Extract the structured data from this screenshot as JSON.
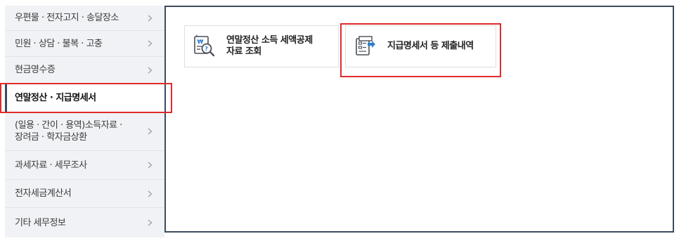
{
  "sidebar": {
    "items": [
      {
        "label": "우편물 · 전자고지 · 송달장소",
        "has_chevron": true,
        "active": false
      },
      {
        "label": "민원 · 상담 · 불복 · 고충",
        "has_chevron": true,
        "active": false
      },
      {
        "label": "현금영수증",
        "has_chevron": true,
        "active": false
      },
      {
        "label": "연말정산 · 지급명세서",
        "has_chevron": false,
        "active": true
      },
      {
        "label_line1": "(일용 · 간이 · 용역)소득자료 ·",
        "label_line2": "장려금 · 학자금상환",
        "has_chevron": true,
        "active": false
      },
      {
        "label": "과세자료 · 세무조사",
        "has_chevron": true,
        "active": false
      },
      {
        "label": "전자세금계산서",
        "has_chevron": true,
        "active": false
      },
      {
        "label": "기타 세무정보",
        "has_chevron": true,
        "active": false
      }
    ]
  },
  "main": {
    "cards": [
      {
        "line1": "연말정산 소득 세액공제",
        "line2": "자료 조회",
        "icon": "document-search-icon"
      },
      {
        "line1": "지급명세서 등 제출내역",
        "icon": "document-submit-icon"
      }
    ]
  },
  "colors": {
    "sidebar_bg": "#f1f2f5",
    "active_border": "#3c4a5e",
    "highlight": "#e02b2b",
    "icon_blue": "#2f7fd1"
  }
}
